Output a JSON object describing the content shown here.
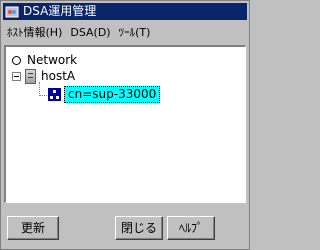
{
  "window": {
    "title": "DSA運用管理"
  },
  "menu": {
    "items": [
      {
        "label": "ﾎｽﾄ情報(H)"
      },
      {
        "label": "DSA(D)"
      },
      {
        "label": "ﾂｰﾙ(T)"
      }
    ]
  },
  "tree": {
    "network_label": "Network",
    "host_label": "hostA",
    "entry_label": "cn=sup-33000"
  },
  "buttons": {
    "update": "更新",
    "close": "閉じる",
    "help": "ﾍﾙﾌﾟ"
  },
  "colors": {
    "titlebar": "#0a246a",
    "selection": "#00ffff",
    "window_bg": "#c0c0c0"
  }
}
